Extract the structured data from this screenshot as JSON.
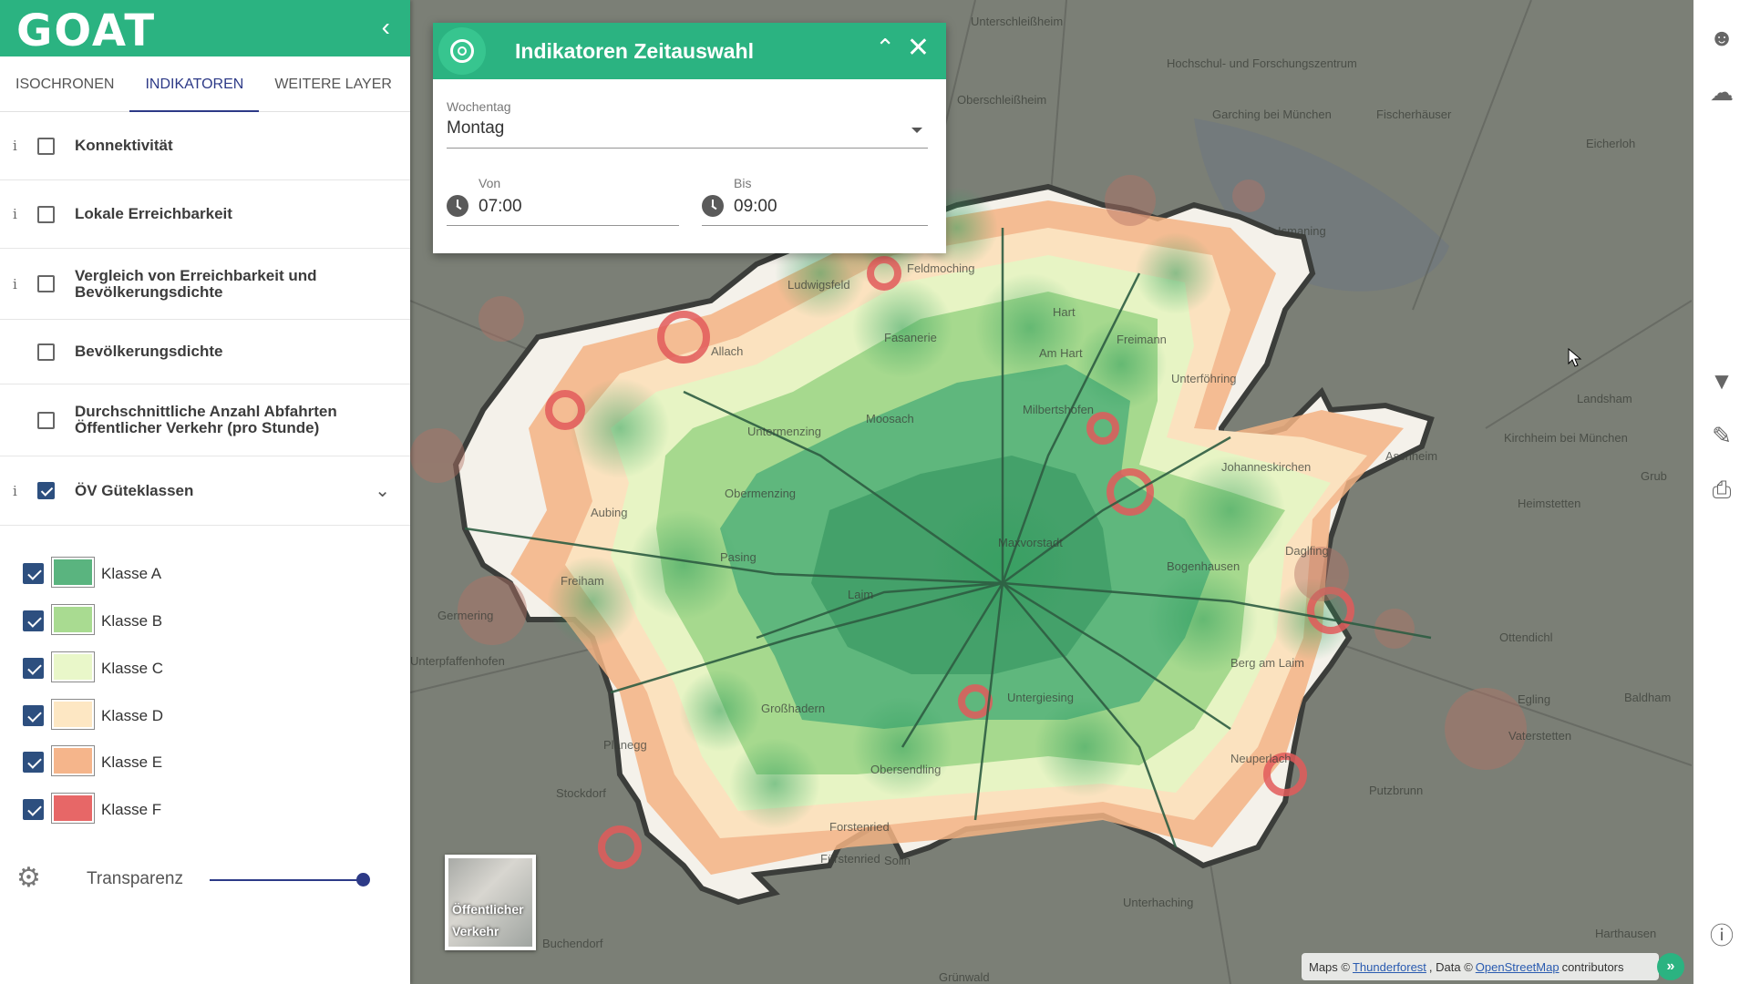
{
  "app": {
    "logo": "GOAT"
  },
  "sidebar": {
    "tabs": [
      {
        "label": "ISOCHRONEN",
        "active": false
      },
      {
        "label": "INDIKATOREN",
        "active": true
      },
      {
        "label": "WEITERE LAYER",
        "active": false
      }
    ],
    "indicators": [
      {
        "label": "Konnektivität",
        "info": "i",
        "checked": false
      },
      {
        "label": "Lokale Erreichbarkeit",
        "info": "i",
        "checked": false
      },
      {
        "label": "Vergleich von Erreichbarkeit und Bevölkerungsdichte",
        "info": "i",
        "checked": false
      },
      {
        "label": "Bevölkerungsdichte",
        "info": "",
        "checked": false
      },
      {
        "label": "Durchschnittliche Anzahl Abfahrten Öffentlicher Verkehr (pro Stunde)",
        "info": "",
        "checked": false
      },
      {
        "label": "ÖV Güteklassen",
        "info": "i",
        "checked": true
      }
    ],
    "legend": [
      {
        "label": "Klasse A",
        "color": "#5ab47f",
        "checked": true
      },
      {
        "label": "Klasse B",
        "color": "#a9db91",
        "checked": true
      },
      {
        "label": "Klasse C",
        "color": "#e9f7c9",
        "checked": true
      },
      {
        "label": "Klasse D",
        "color": "#fde7c3",
        "checked": true
      },
      {
        "label": "Klasse E",
        "color": "#f5b58b",
        "checked": true
      },
      {
        "label": "Klasse F",
        "color": "#e76767",
        "checked": true
      }
    ],
    "transparency": {
      "label": "Transparenz",
      "value": 1.0
    }
  },
  "dialog": {
    "title": "Indikatoren Zeitauswahl",
    "weekday": {
      "label": "Wochentag",
      "value": "Montag"
    },
    "from": {
      "label": "Von",
      "value": "07:00"
    },
    "to": {
      "label": "Bis",
      "value": "09:00"
    }
  },
  "map": {
    "layer_switch": {
      "line1": "Öffentlicher",
      "line2": "Verkehr"
    },
    "attribution": {
      "prefix": "Maps ©",
      "link1": "Thunderforest",
      "middle": ", Data ©",
      "link2": "OpenStreetMap",
      "suffix": "contributors",
      "button": "»"
    },
    "places": [
      "Unterschleißheim",
      "Hochschul- und Forschungszentrum",
      "Oberschleißheim",
      "Garching bei München",
      "Fischerhäuser",
      "Eicherloh",
      "Ismaning",
      "Ludwigsfeld",
      "Feldmoching",
      "Fasanerie",
      "Hart",
      "Freimann",
      "Am Hart",
      "Allach",
      "Milbertshofen",
      "Unterföhring",
      "Landsham",
      "Aubing",
      "Untermenzing",
      "Obermenzing",
      "Moosach",
      "Aschheim",
      "Kirchheim bei München",
      "Johanneskirchen",
      "Heimstetten",
      "Grub",
      "Pasing",
      "Freiham",
      "Bogenhausen",
      "Daglfing",
      "Maxvorstadt",
      "Laim",
      "Germering",
      "Unterpfaffenhofen",
      "Ottendichl",
      "Großhadern",
      "Planegg",
      "Untergiesing",
      "Berg am Laim",
      "Baldham",
      "Egling",
      "Obersendling",
      "Neuperlach",
      "Vaterstetten",
      "Stockdorf",
      "Forstenried",
      "Fürstenried",
      "Solln",
      "Unterhaching",
      "Buchendorf",
      "Harthausen",
      "Grünwald",
      "Putzbrunn"
    ]
  },
  "colors": {
    "brand": "#2bb381",
    "accent": "#2d3a87",
    "checkbox": "#2d4f7f"
  },
  "toolbar_icons": [
    "user-icon",
    "cloud-icon",
    "filter-icon",
    "edit-icon",
    "print-icon",
    "info-icon"
  ]
}
